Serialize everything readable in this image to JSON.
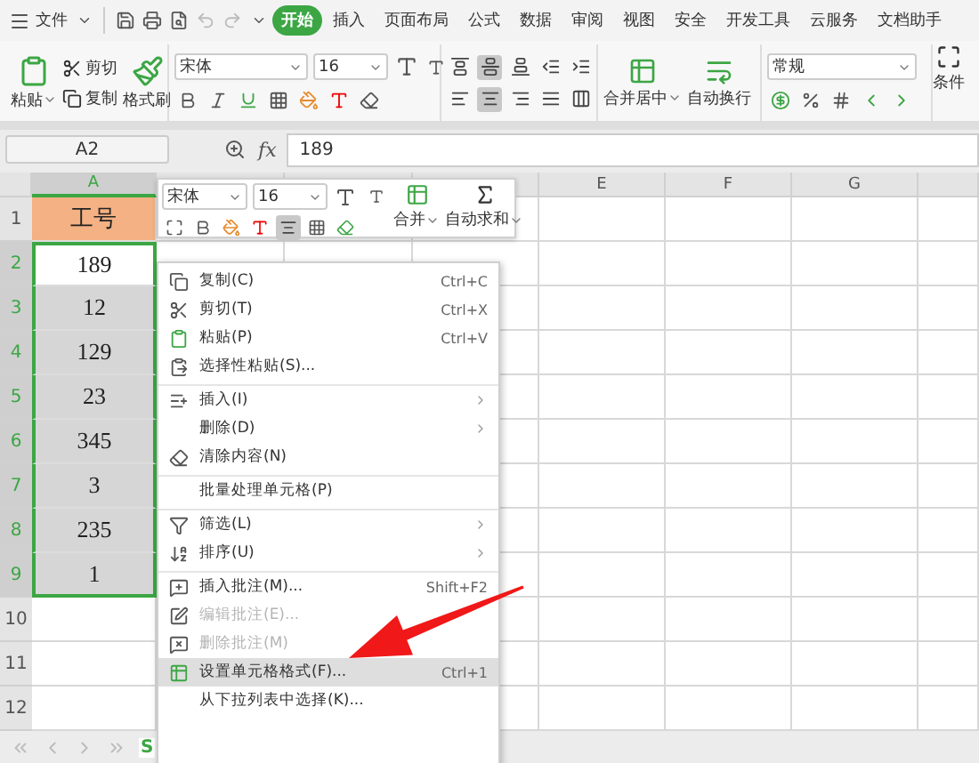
{
  "menu_bar": {
    "file": "文件",
    "tabs": [
      {
        "label": "开始",
        "selected": true
      },
      {
        "label": "插入",
        "selected": false
      },
      {
        "label": "页面布局",
        "selected": false
      },
      {
        "label": "公式",
        "selected": false
      },
      {
        "label": "数据",
        "selected": false
      },
      {
        "label": "审阅",
        "selected": false
      },
      {
        "label": "视图",
        "selected": false
      },
      {
        "label": "安全",
        "selected": false
      },
      {
        "label": "开发工具",
        "selected": false
      },
      {
        "label": "云服务",
        "selected": false
      },
      {
        "label": "文档助手",
        "selected": false
      }
    ]
  },
  "ribbon": {
    "paste": "粘贴",
    "cut": "剪切",
    "copy": "复制",
    "format_painter": "格式刷",
    "font_name": "宋体",
    "font_size": "16",
    "alignment": [
      {
        "kind": "top",
        "selected": false
      },
      {
        "kind": "middle",
        "selected": true
      },
      {
        "kind": "bottom",
        "selected": false
      },
      {
        "kind": "outdent",
        "selected": false
      },
      {
        "kind": "indent",
        "selected": false
      },
      {
        "kind": "left",
        "selected": false
      },
      {
        "kind": "center",
        "selected": true
      },
      {
        "kind": "right",
        "selected": false
      },
      {
        "kind": "justify",
        "selected": false
      },
      {
        "kind": "distributed",
        "selected": false
      }
    ],
    "merge": "合并居中",
    "wrap": "自动换行",
    "number_format": "常规",
    "conditional": "条件"
  },
  "formula_bar": {
    "name_box": "A2",
    "fx": "fx",
    "value": "189"
  },
  "columns": [
    {
      "label": "A",
      "selected": true
    },
    {
      "selected": false
    },
    {
      "selected": false
    },
    {
      "selected": false
    },
    {
      "label": "E",
      "selected": false
    },
    {
      "label": "F",
      "selected": false
    },
    {
      "label": "G",
      "selected": false
    }
  ],
  "rows": [
    {
      "number": "1",
      "selected": false,
      "cells": [
        {
          "text": "工号",
          "color": "#f4b183"
        }
      ]
    },
    {
      "number": "2",
      "selected": true,
      "cells": [
        {
          "text": "189",
          "active": true
        }
      ]
    },
    {
      "number": "3",
      "selected": true,
      "cells": [
        {
          "text": "12"
        }
      ]
    },
    {
      "number": "4",
      "selected": true,
      "cells": [
        {
          "text": "129"
        }
      ]
    },
    {
      "number": "5",
      "selected": true,
      "cells": [
        {
          "text": "23"
        }
      ]
    },
    {
      "number": "6",
      "selected": true,
      "cells": [
        {
          "text": "345"
        }
      ]
    },
    {
      "number": "7",
      "selected": true,
      "cells": [
        {
          "text": "3"
        }
      ]
    },
    {
      "number": "8",
      "selected": true,
      "cells": [
        {
          "text": "235"
        }
      ]
    },
    {
      "number": "9",
      "selected": true,
      "cells": [
        {
          "text": "1"
        }
      ]
    },
    {
      "number": "10",
      "selected": false,
      "cells": []
    },
    {
      "number": "11",
      "selected": false,
      "cells": []
    },
    {
      "number": "12",
      "selected": false,
      "cells": []
    }
  ],
  "mini_toolbar": {
    "font_name": "宋体",
    "font_size": "16",
    "merge": "合并",
    "autosum": "自动求和"
  },
  "context_menu": {
    "items": [
      {
        "kind": "copy",
        "label": "复制(C)",
        "shortcut": "Ctrl+C",
        "submenu": false,
        "disabled": false,
        "selected": false,
        "separator_before": false
      },
      {
        "kind": "cut",
        "label": "剪切(T)",
        "shortcut": "Ctrl+X",
        "submenu": false,
        "disabled": false,
        "selected": false,
        "separator_before": false
      },
      {
        "kind": "paste",
        "label": "粘贴(P)",
        "shortcut": "Ctrl+V",
        "submenu": false,
        "disabled": false,
        "selected": false,
        "separator_before": false
      },
      {
        "kind": "paste-special",
        "label": "选择性粘贴(S)...",
        "submenu": false,
        "disabled": false,
        "selected": false,
        "separator_before": false
      },
      {
        "kind": "insert",
        "label": "插入(I)",
        "submenu": true,
        "disabled": false,
        "selected": false,
        "separator_before": true
      },
      {
        "kind": "plain",
        "label": "删除(D)",
        "submenu": true,
        "disabled": false,
        "selected": false,
        "separator_before": false
      },
      {
        "kind": "clear",
        "label": "清除内容(N)",
        "submenu": false,
        "disabled": false,
        "selected": false,
        "separator_before": false
      },
      {
        "kind": "plain",
        "label": "批量处理单元格(P)",
        "submenu": false,
        "disabled": false,
        "selected": false,
        "separator_before": true
      },
      {
        "kind": "filter",
        "label": "筛选(L)",
        "submenu": true,
        "disabled": false,
        "selected": false,
        "separator_before": true
      },
      {
        "kind": "sort",
        "label": "排序(U)",
        "submenu": true,
        "disabled": false,
        "selected": false,
        "separator_before": false
      },
      {
        "kind": "comment",
        "label": "插入批注(M)...",
        "shortcut": "Shift+F2",
        "submenu": false,
        "disabled": false,
        "selected": false,
        "separator_before": true
      },
      {
        "kind": "edit-comment",
        "label": "编辑批注(E)...",
        "submenu": false,
        "disabled": true,
        "selected": false,
        "separator_before": false
      },
      {
        "kind": "delete-comment",
        "label": "删除批注(M)",
        "submenu": false,
        "disabled": true,
        "selected": false,
        "separator_before": false
      },
      {
        "kind": "format",
        "label": "设置单元格格式(F)...",
        "shortcut": "Ctrl+1",
        "submenu": false,
        "disabled": false,
        "selected": true,
        "separator_before": false
      },
      {
        "kind": "plain",
        "label": "从下拉列表中选择(K)...",
        "submenu": false,
        "disabled": false,
        "selected": false,
        "separator_before": false
      }
    ]
  },
  "sheet_tabs": [
    {
      "label": "S",
      "selected": true
    }
  ]
}
